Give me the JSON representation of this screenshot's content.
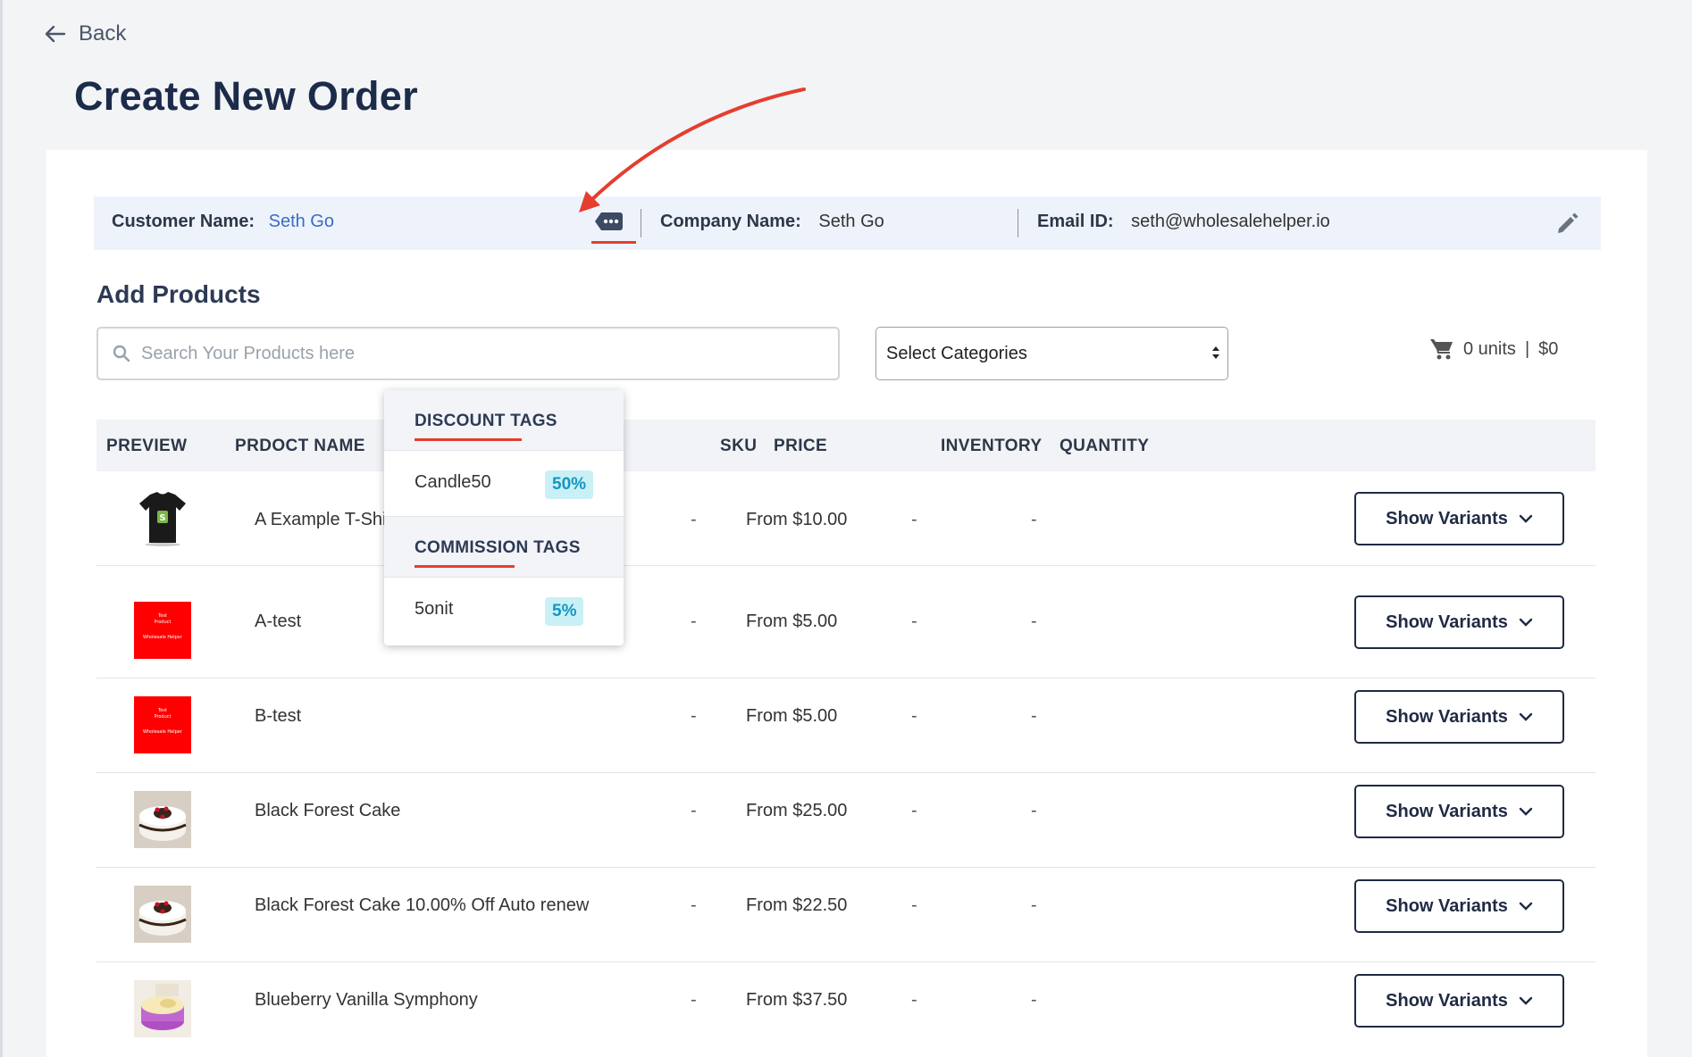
{
  "nav": {
    "back_label": "Back"
  },
  "page": {
    "title": "Create New Order"
  },
  "customer": {
    "customer_label": "Customer Name:",
    "customer_value": "Seth Go",
    "company_label": "Company Name:",
    "company_value": "Seth Go",
    "email_label": "Email ID:",
    "email_value": "seth@wholesalehelper.io"
  },
  "add_products": {
    "title": "Add Products",
    "search_placeholder": "Search Your Products here",
    "category_select": "Select Categories",
    "cart_units": "0 units",
    "cart_separator": "|",
    "cart_total": "$0"
  },
  "table": {
    "headers": [
      "PREVIEW",
      "PRDOCT NAME",
      "SKU",
      "PRICE",
      "INVENTORY",
      "QUANTITY"
    ],
    "rows": [
      {
        "name": "A Example T-Shirt",
        "sku": "-",
        "price": "From $10.00",
        "inventory": "-",
        "quantity": "-",
        "thumb": "tshirt"
      },
      {
        "name": "A-test",
        "sku": "-",
        "price": "From $5.00",
        "inventory": "-",
        "quantity": "-",
        "thumb": "red-card"
      },
      {
        "name": "B-test",
        "sku": "-",
        "price": "From $5.00",
        "inventory": "-",
        "quantity": "-",
        "thumb": "red-card"
      },
      {
        "name": "Black Forest Cake",
        "sku": "-",
        "price": "From $25.00",
        "inventory": "-",
        "quantity": "-",
        "thumb": "cake"
      },
      {
        "name": "Black Forest Cake 10.00% Off Auto renew",
        "sku": "-",
        "price": "From $22.50",
        "inventory": "-",
        "quantity": "-",
        "thumb": "cake"
      },
      {
        "name": "Blueberry Vanilla Symphony",
        "sku": "-",
        "price": "From $37.50",
        "inventory": "-",
        "quantity": "-",
        "thumb": "purple-cake"
      }
    ],
    "variants_label": "Show Variants"
  },
  "thumb_text": {
    "line1": "Test",
    "line2": "Product",
    "line3": "Wholesale Helper"
  },
  "tags_popup": {
    "discount_title": "DISCOUNT TAGS",
    "discount_items": [
      {
        "name": "Candle50",
        "value": "50%"
      }
    ],
    "commission_title": "COMMISSION TAGS",
    "commission_items": [
      {
        "name": "5onit",
        "value": "5%"
      }
    ]
  },
  "colors": {
    "accent_link": "#3a6cc6",
    "annotation_red": "#e53e2e",
    "badge_bg": "#c9f0f6",
    "badge_text": "#1596c0",
    "heading": "#1c2b4a"
  },
  "icons": [
    "arrow-left-icon",
    "tag-more-icon",
    "pencil-icon",
    "search-icon",
    "select-arrows-icon",
    "cart-icon",
    "chevron-down-icon"
  ]
}
